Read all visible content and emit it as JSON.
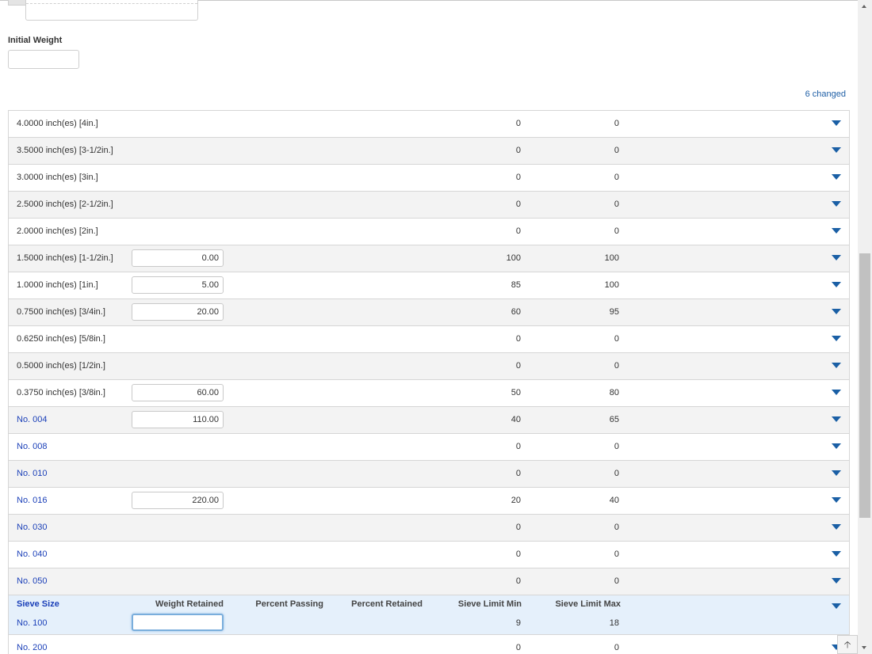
{
  "form": {
    "initial_weight_label": "Initial Weight",
    "initial_weight_value": "",
    "changed_count": "6 changed"
  },
  "table": {
    "headers": {
      "sieve_size": "Sieve Size",
      "weight_retained": "Weight Retained",
      "percent_passing": "Percent Passing",
      "percent_retained": "Percent Retained",
      "sieve_limit_min": "Sieve Limit Min",
      "sieve_limit_max": "Sieve Limit Max"
    },
    "rows": [
      {
        "sieve": "4.0000 inch(es) [4in.]",
        "weight": null,
        "min": "0",
        "max": "0",
        "link": false
      },
      {
        "sieve": "3.5000 inch(es) [3-1/2in.]",
        "weight": null,
        "min": "0",
        "max": "0",
        "link": false
      },
      {
        "sieve": "3.0000 inch(es) [3in.]",
        "weight": null,
        "min": "0",
        "max": "0",
        "link": false
      },
      {
        "sieve": "2.5000 inch(es) [2-1/2in.]",
        "weight": null,
        "min": "0",
        "max": "0",
        "link": false
      },
      {
        "sieve": "2.0000 inch(es) [2in.]",
        "weight": null,
        "min": "0",
        "max": "0",
        "link": false
      },
      {
        "sieve": "1.5000 inch(es) [1-1/2in.]",
        "weight": "0.00",
        "min": "100",
        "max": "100",
        "link": false
      },
      {
        "sieve": "1.0000 inch(es) [1in.]",
        "weight": "5.00",
        "min": "85",
        "max": "100",
        "link": false
      },
      {
        "sieve": "0.7500 inch(es) [3/4in.]",
        "weight": "20.00",
        "min": "60",
        "max": "95",
        "link": false
      },
      {
        "sieve": "0.6250 inch(es) [5/8in.]",
        "weight": null,
        "min": "0",
        "max": "0",
        "link": false
      },
      {
        "sieve": "0.5000 inch(es) [1/2in.]",
        "weight": null,
        "min": "0",
        "max": "0",
        "link": false
      },
      {
        "sieve": "0.3750 inch(es) [3/8in.]",
        "weight": "60.00",
        "min": "50",
        "max": "80",
        "link": false
      },
      {
        "sieve": "No. 004",
        "weight": "110.00",
        "min": "40",
        "max": "65",
        "link": true
      },
      {
        "sieve": "No. 008",
        "weight": null,
        "min": "0",
        "max": "0",
        "link": true
      },
      {
        "sieve": "No. 010",
        "weight": null,
        "min": "0",
        "max": "0",
        "link": true
      },
      {
        "sieve": "No. 016",
        "weight": "220.00",
        "min": "20",
        "max": "40",
        "link": true
      },
      {
        "sieve": "No. 030",
        "weight": null,
        "min": "0",
        "max": "0",
        "link": true
      },
      {
        "sieve": "No. 040",
        "weight": null,
        "min": "0",
        "max": "0",
        "link": true
      },
      {
        "sieve": "No. 050",
        "weight": null,
        "min": "0",
        "max": "0",
        "link": true
      }
    ],
    "active_row": {
      "sieve": "No. 100",
      "weight": "",
      "min": "9",
      "max": "18"
    },
    "after_rows": [
      {
        "sieve": "No. 200",
        "weight": null,
        "min": "0",
        "max": "0",
        "link": true
      }
    ]
  },
  "colors": {
    "link": "#1a3fb8",
    "caret": "#1a5fa5",
    "active_row_bg": "#e5f0fb",
    "alt_row_bg": "#f3f3f3"
  },
  "icons": {
    "expand": "caret-down-icon",
    "back_to_top": "arrow-up-icon"
  },
  "back_to_top_glyph": "🡡"
}
